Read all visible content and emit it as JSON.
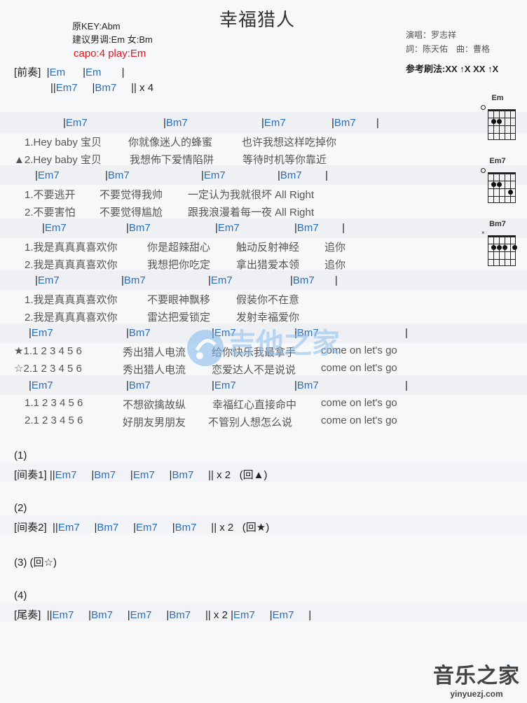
{
  "header": {
    "title": "幸福猎人",
    "orig_key": "原KEY:Abm",
    "suggest_key": "建议男调:Em 女:Bm",
    "capo": "capo:4 play:Em",
    "singer": "演唱：罗志祥",
    "lyricist_composer": "詞：陈天佑　曲：曹格",
    "strum": "参考刷法:XX ↑X XX ↑X"
  },
  "intro": {
    "label": "[前奏]",
    "line1_chords": [
      "Em",
      "Em"
    ],
    "line2_chords": [
      "Em7",
      "Bm7"
    ],
    "line2_repeat": "x 4"
  },
  "verse": {
    "chords_a": [
      "Em7",
      "Bm7",
      "Em7",
      "Bm7"
    ],
    "lyr_a1": [
      "1.Hey baby 宝贝",
      "你就像迷人的蜂蜜",
      "也许我想这样吃掉你"
    ],
    "lyr_a2": [
      "▲2.Hey baby 宝贝",
      "我想佈下爱情陷阱",
      "等待时机等你靠近"
    ],
    "chords_b": [
      "Em7",
      "Bm7",
      "Em7",
      "Bm7"
    ],
    "lyr_b1": [
      "1.不要逃开",
      "不要觉得我帅",
      "一定认为我就很坏 All Right"
    ],
    "lyr_b2": [
      "2.不要害怕",
      "不要觉得尴尬",
      "跟我浪漫着每一夜 All Right"
    ],
    "chords_c": [
      "Em7",
      "Bm7",
      "Em7",
      "Bm7"
    ],
    "lyr_c1": [
      "1.我是真真真喜欢你",
      "你是超辣甜心",
      "触动反射神经",
      "追你"
    ],
    "lyr_c2": [
      "2.我是真真真喜欢你",
      "我想把你吃定",
      "拿出猎爱本领",
      "追你"
    ],
    "chords_d": [
      "Em7",
      "Bm7",
      "Em7",
      "Bm7"
    ],
    "lyr_d1": [
      "1.我是真真真喜欢你",
      "不要眼神飘移",
      "假装你不在意"
    ],
    "lyr_d2": [
      "2.我是真真真喜欢你",
      "雷达把爱锁定",
      "发射幸福爱你"
    ]
  },
  "chorus": {
    "chords_a": [
      "Em7",
      "Bm7",
      "Em7",
      "Bm7"
    ],
    "lyr_a1": [
      "★1.1 2 3 4 5 6",
      "秀出猎人电流",
      "给你快乐我最拿手",
      "come on let's go"
    ],
    "lyr_a2": [
      "☆2.1 2 3 4 5 6",
      "秀出猎人电流",
      "恋爱达人不是说说",
      "come on let's go"
    ],
    "chords_b": [
      "Em7",
      "Bm7",
      "Em7",
      "Bm7"
    ],
    "lyr_b1": [
      "1.1 2 3 4 5 6",
      "不想欲擒故纵",
      "幸福红心直接命中",
      "come on let's go"
    ],
    "lyr_b2": [
      "2.1 2 3 4 5 6",
      "好朋友男朋友",
      "不管别人想怎么说",
      "come on let's go"
    ]
  },
  "sections": {
    "s1_num": "(1)",
    "s1_label": "[间奏1]",
    "s1_chords": [
      "Em7",
      "Bm7",
      "Em7",
      "Bm7"
    ],
    "s1_repeat": "x 2",
    "s1_back": "(回▲)",
    "s2_num": "(2)",
    "s2_label": "[间奏2]",
    "s2_chords": [
      "Em7",
      "Bm7",
      "Em7",
      "Bm7"
    ],
    "s2_repeat": "x 2",
    "s2_back": "(回★)",
    "s3": "(3) (回☆)",
    "s4_num": "(4)",
    "s4_label": "[尾奏]",
    "s4_chords": [
      "Em7",
      "Bm7",
      "Em7",
      "Bm7",
      "Em7",
      "Em7"
    ],
    "s4_repeat": "x 2"
  },
  "chord_diagrams": [
    {
      "name": "Em"
    },
    {
      "name": "Em7"
    },
    {
      "name": "Bm7"
    }
  ],
  "watermark": {
    "text": "吉他之家"
  },
  "footer_logo": {
    "text": "音乐之家",
    "url": "yinyuezj.com"
  }
}
